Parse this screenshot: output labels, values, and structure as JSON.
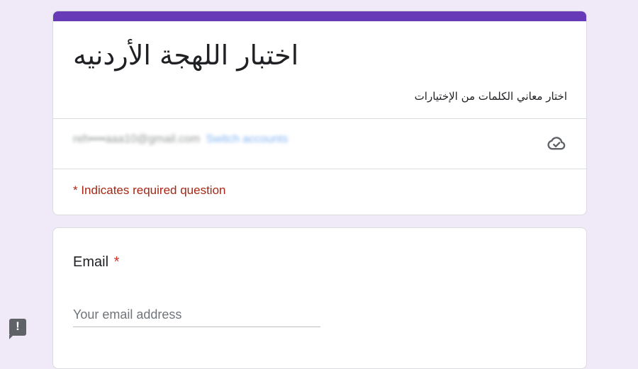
{
  "form": {
    "accent_color": "#673ab7",
    "title": "اختبار اللهجة الأردنيه",
    "description": "اختار معاني الكلمات من الإختيارات",
    "account": {
      "email": "reh••••aaa10@gmail.com",
      "switch_label": "Switch accounts",
      "cloud_icon": "cloud-done-icon"
    },
    "required_note": "* Indicates required question"
  },
  "question": {
    "label": "Email",
    "required_mark": "*",
    "placeholder": "Your email address"
  },
  "report_button": {
    "icon": "exclamation-icon",
    "glyph": "!"
  }
}
